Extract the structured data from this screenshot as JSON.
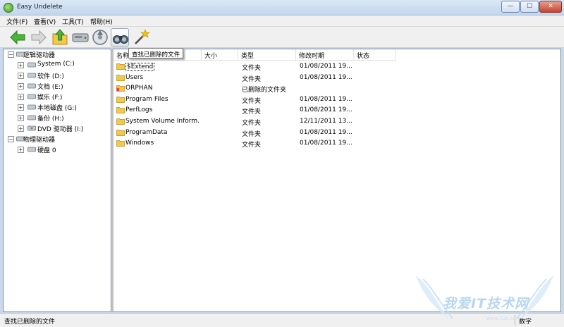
{
  "window": {
    "title": "Easy Undelete",
    "minimize": "—",
    "maximize": "☐",
    "close": "✕"
  },
  "menu": [
    {
      "label": "文件(F)"
    },
    {
      "label": "查看(V)"
    },
    {
      "label": "工具(T)"
    },
    {
      "label": "帮助(H)"
    }
  ],
  "toolbar": {
    "buttons": [
      {
        "icon": "back-arrow-icon"
      },
      {
        "icon": "forward-arrow-icon"
      },
      {
        "icon": "up-folder-icon"
      },
      {
        "icon": "drive-icon"
      },
      {
        "icon": "scan-disk-icon"
      },
      {
        "icon": "binoculars-icon"
      },
      {
        "icon": "magic-wand-icon"
      }
    ],
    "tooltip": "查找已删除的文件"
  },
  "tree": {
    "logical_root": "逻辑驱动器",
    "physical_root": "物理驱动器",
    "logical_drives": [
      {
        "label": "System (C:)"
      },
      {
        "label": "软件 (D:)"
      },
      {
        "label": "文档 (E:)"
      },
      {
        "label": "娱乐 (F:)"
      },
      {
        "label": "本地磁盘 (G:)"
      },
      {
        "label": "备份 (H:)"
      },
      {
        "label": "DVD 驱动器 (I:)"
      }
    ],
    "physical_drives": [
      {
        "label": "硬盘 0"
      }
    ],
    "expand_glyph": "+",
    "collapse_glyph": "−"
  },
  "list": {
    "columns": {
      "name": "名称",
      "size": "大小",
      "type": "类型",
      "modified": "修改时期",
      "status": "状态"
    },
    "rows": [
      {
        "name": "$Extend",
        "size": "",
        "type": "文件夹",
        "modified": "01/08/2011  19...",
        "status": "",
        "icon": "folder"
      },
      {
        "name": "Users",
        "size": "",
        "type": "文件夹",
        "modified": "01/08/2011  19...",
        "status": "",
        "icon": "folder"
      },
      {
        "name": "ORPHAN",
        "size": "",
        "type": "已删除的文件夹",
        "modified": "",
        "status": "",
        "icon": "deleted-folder"
      },
      {
        "name": "Program Files",
        "size": "",
        "type": "文件夹",
        "modified": "01/08/2011  19...",
        "status": "",
        "icon": "folder"
      },
      {
        "name": "PerfLogs",
        "size": "",
        "type": "文件夹",
        "modified": "01/08/2011  19...",
        "status": "",
        "icon": "folder"
      },
      {
        "name": "System Volume Inform...",
        "size": "",
        "type": "文件夹",
        "modified": "12/11/2011  13...",
        "status": "",
        "icon": "folder"
      },
      {
        "name": "ProgramData",
        "size": "",
        "type": "文件夹",
        "modified": "01/08/2011  19...",
        "status": "",
        "icon": "folder"
      },
      {
        "name": "Windows",
        "size": "",
        "type": "文件夹",
        "modified": "01/08/2011  19...",
        "status": "",
        "icon": "folder"
      }
    ]
  },
  "status": {
    "text": "查找已删除的文件",
    "mode": "数字"
  },
  "watermark": {
    "text": "我爱IT技术网",
    "url": "www.52ij.com"
  },
  "colors": {
    "folder": "#f2c94c",
    "deleted_marker": "#d9302c",
    "titlebar": "#c9d9ec"
  }
}
